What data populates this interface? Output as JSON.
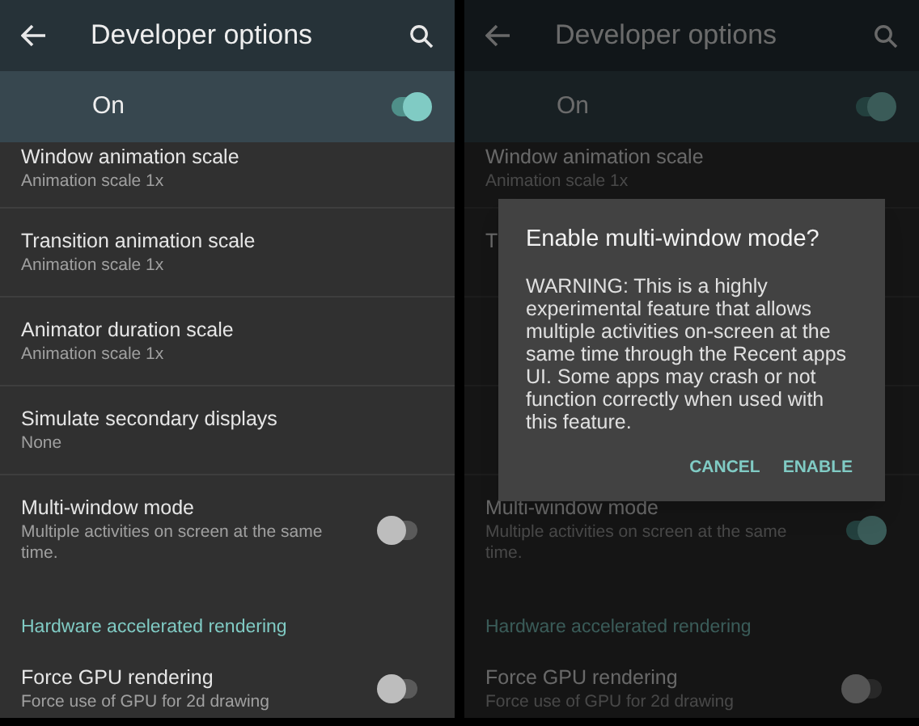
{
  "screens": [
    {
      "title": "Developer options",
      "dimmed": false,
      "master": {
        "label": "On",
        "on": true
      },
      "items": [
        {
          "kind": "setting",
          "title": "Window animation scale",
          "subtitle": "Animation scale 1x"
        },
        {
          "kind": "setting",
          "title": "Transition animation scale",
          "subtitle": "Animation scale 1x"
        },
        {
          "kind": "setting",
          "title": "Animator duration scale",
          "subtitle": "Animation scale 1x"
        },
        {
          "kind": "setting",
          "title": "Simulate secondary displays",
          "subtitle": "None"
        },
        {
          "kind": "toggle",
          "title": "Multi-window mode",
          "subtitle": "Multiple activities on screen at the same time.",
          "on": false
        },
        {
          "kind": "header",
          "title": "Hardware accelerated rendering"
        },
        {
          "kind": "toggle",
          "title": "Force GPU rendering",
          "subtitle": "Force use of GPU for 2d drawing",
          "on": false
        }
      ]
    },
    {
      "title": "Developer options",
      "dimmed": true,
      "master": {
        "label": "On",
        "on": true
      },
      "items": [
        {
          "kind": "setting",
          "title": "Window animation scale",
          "subtitle": "Animation scale 1x"
        },
        {
          "kind": "setting",
          "title": "T"
        },
        {
          "kind": "setting"
        },
        {
          "kind": "setting"
        },
        {
          "kind": "toggle",
          "title": "Multi-window mode",
          "subtitle": "Multiple activities on screen at the same time.",
          "on": true
        },
        {
          "kind": "header",
          "title": "Hardware accelerated rendering"
        },
        {
          "kind": "toggle",
          "title": "Force GPU rendering",
          "subtitle": "Force use of GPU for 2d drawing",
          "on": false
        }
      ],
      "dialog": {
        "title": "Enable multi-window mode?",
        "message": "WARNING: This is a highly experimental feature that allows multiple activities on-screen at the same time through the Recent apps UI. Some apps may crash or not function correctly when used with this feature.",
        "buttons": [
          "CANCEL",
          "ENABLE"
        ]
      }
    }
  ]
}
